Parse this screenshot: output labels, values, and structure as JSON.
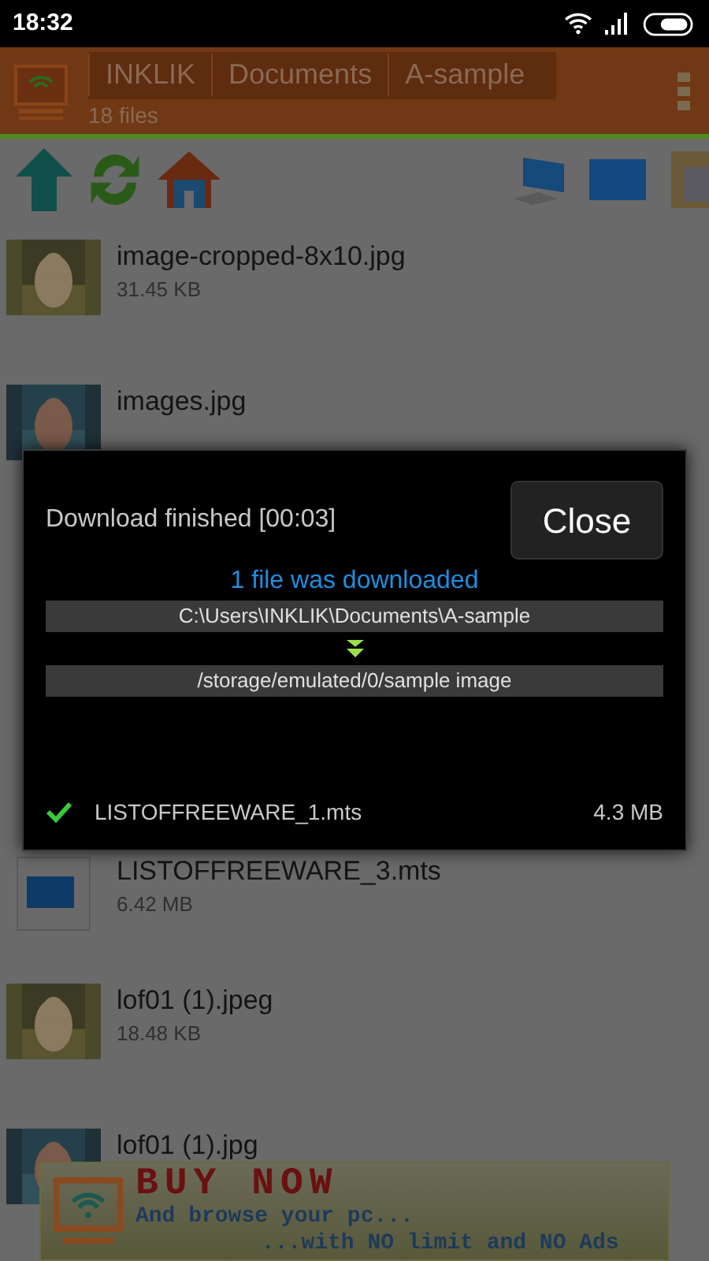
{
  "status_bar": {
    "time": "18:32"
  },
  "header": {
    "breadcrumbs": [
      "INKLIK",
      "Documents",
      "A-sample"
    ],
    "file_count": "18 files"
  },
  "files": [
    {
      "name": "image-cropped-8x10.jpg",
      "size": "31.45 KB",
      "kind": "picture"
    },
    {
      "name": "images.jpg",
      "kind": "picture"
    },
    {
      "name": "LISTOFFREEWARE_3.mts",
      "size": "6.42 MB",
      "kind": "video"
    },
    {
      "name": "lof01 (1).jpeg",
      "size": "18.48 KB",
      "kind": "picture"
    },
    {
      "name": "lof01 (1).jpg",
      "kind": "picture"
    }
  ],
  "dialog": {
    "title": "Download finished [00:03]",
    "close_button": "Close",
    "summary": "1 file was downloaded",
    "source": "C:\\Users\\INKLIK\\Documents\\A-sample",
    "destination": "/storage/emulated/0/sample image",
    "items": [
      {
        "name": "LISTOFFREEWARE_1.mts",
        "size": "4.3 MB",
        "done": true
      }
    ]
  },
  "ad": {
    "headline": "BUY NOW",
    "line1": "And browse your pc...",
    "line2": "...with NO limit and NO Ads"
  }
}
